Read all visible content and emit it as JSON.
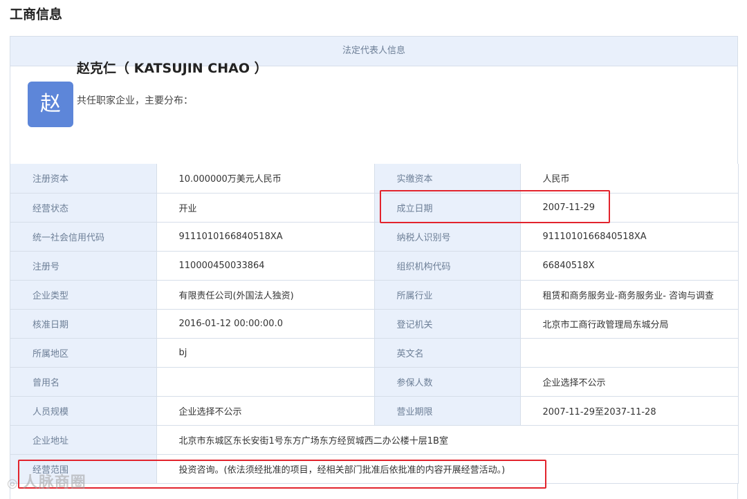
{
  "page_title": "工商信息",
  "section_header": "法定代表人信息",
  "person": {
    "avatar_char": "赵",
    "name": "赵克仁（ KATSUJIN CHAO ）",
    "subtitle": "共任职家企业，主要分布："
  },
  "rows": [
    {
      "l1": "注册资本",
      "v1": "10.000000万美元人民币",
      "l2": "实缴资本",
      "v2": "人民币"
    },
    {
      "l1": "经营状态",
      "v1": "开业",
      "l2": "成立日期",
      "v2": "2007-11-29"
    },
    {
      "l1": "统一社会信用代码",
      "v1": "9111010166840518XA",
      "l2": "纳税人识别号",
      "v2": "9111010166840518XA"
    },
    {
      "l1": "注册号",
      "v1": "110000450033864",
      "l2": "组织机构代码",
      "v2": "66840518X"
    },
    {
      "l1": "企业类型",
      "v1": "有限责任公司(外国法人独资)",
      "l2": "所属行业",
      "v2": "租赁和商务服务业-商务服务业- 咨询与调查"
    },
    {
      "l1": "核准日期",
      "v1": "2016-01-12 00:00:00.0",
      "l2": "登记机关",
      "v2": "北京市工商行政管理局东城分局"
    },
    {
      "l1": "所属地区",
      "v1": "bj",
      "l2": "英文名",
      "v2": ""
    },
    {
      "l1": "曾用名",
      "v1": "",
      "l2": "参保人数",
      "v2": "企业选择不公示"
    },
    {
      "l1": "人员规模",
      "v1": "企业选择不公示",
      "l2": "营业期限",
      "v2": "2007-11-29至2037-11-28"
    }
  ],
  "address": {
    "label": "企业地址",
    "value": "北京市东城区东长安街1号东方广场东方经贸城西二办公楼十层1B室"
  },
  "scope": {
    "label": "经营范围",
    "value": "投资咨询。(依法须经批准的项目，经相关部门批准后依批准的内容开展经营活动。)"
  },
  "watermark": "人脉商圈",
  "colors": {
    "highlight": "#e2232c",
    "avatar_bg": "#5d86d9",
    "label_bg": "#e9f0fb"
  }
}
